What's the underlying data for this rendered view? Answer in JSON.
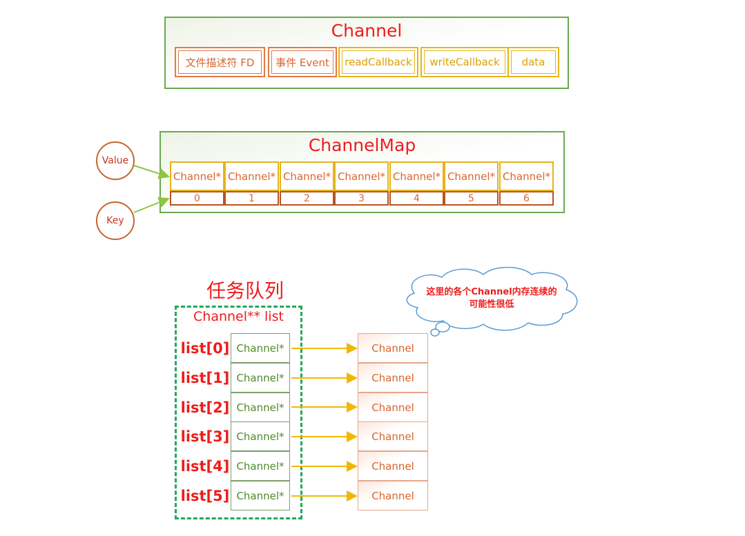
{
  "channel": {
    "title": "Channel",
    "fields": [
      "文件描述符 FD",
      "事件 Event",
      "readCallback",
      "writeCallback",
      "data"
    ]
  },
  "channel_map": {
    "title": "ChannelMap",
    "values": [
      "Channel*",
      "Channel*",
      "Channel*",
      "Channel*",
      "Channel*",
      "Channel*",
      "Channel*"
    ],
    "keys": [
      "0",
      "1",
      "2",
      "3",
      "4",
      "5",
      "6"
    ],
    "value_label": "Value",
    "key_label": "Key"
  },
  "task_queue": {
    "title": "任务队列",
    "subtitle": "Channel** list",
    "labels": [
      "list[0]",
      "list[1]",
      "list[2]",
      "list[3]",
      "list[4]",
      "list[5]"
    ],
    "pointers": [
      "Channel*",
      "Channel*",
      "Channel*",
      "Channel*",
      "Channel*",
      "Channel*"
    ],
    "targets": [
      "Channel",
      "Channel",
      "Channel",
      "Channel",
      "Channel",
      "Channel"
    ],
    "note": "这里的各个Channel内存连续的可能性很低"
  },
  "colors": {
    "title_red": "#ee1c1c",
    "box_green": "#6aa84f",
    "orange": "#e07b45",
    "yellow": "#e6b417",
    "queue_green": "#21a85a",
    "arrow_green": "#8cc63f",
    "arrow_yellow": "#f2b705",
    "cloud_blue": "#5b9bd5"
  }
}
